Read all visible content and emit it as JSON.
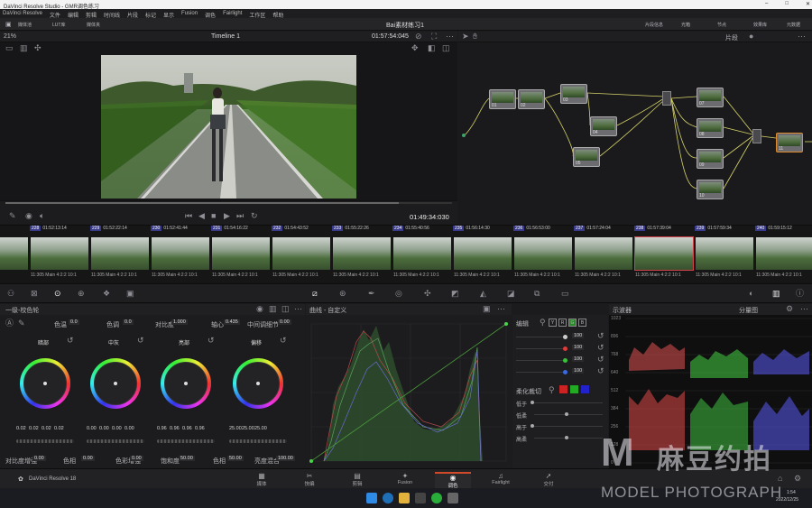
{
  "window": {
    "title": "DaVinci Resolve Studio - GMR调色练习",
    "controls": [
      "–",
      "□",
      "✕"
    ]
  },
  "menu": [
    "DaVinci Resolve",
    "文件",
    "编辑",
    "剪辑",
    "时间线",
    "片段",
    "标记",
    "显示",
    "Fusion",
    "调色",
    "Fairlight",
    "工作区",
    "帮助"
  ],
  "toolbar": {
    "left": [
      "媒体池",
      "LUT库",
      "媒体夹"
    ],
    "project": "Bai素材练习1",
    "right": [
      "片段信息",
      "光箱",
      "节点",
      "效果库",
      "元数据"
    ]
  },
  "viewer": {
    "zoom": "21%",
    "timeline": "Timeline 1",
    "timecode": "01:57:54:045",
    "playhead_tc": "01:49:34:030",
    "progress": 0.88
  },
  "nodes": {
    "mode": "片段",
    "items": [
      {
        "label": "01"
      },
      {
        "label": "02"
      },
      {
        "label": "03"
      },
      {
        "label": "04"
      },
      {
        "label": "05"
      },
      {
        "label": "07"
      },
      {
        "label": "08"
      },
      {
        "label": "09"
      },
      {
        "label": "10"
      },
      {
        "label": "11"
      },
      {
        "label": "12"
      }
    ]
  },
  "clips": [
    {
      "num": "",
      "tc": "4:14",
      "name": "11:305 Main"
    },
    {
      "num": "228",
      "tc": "01:52:13:14",
      "name": "11:305 Main 4:2:2 10:1"
    },
    {
      "num": "229",
      "tc": "01:52:22:14",
      "name": "11:305 Main 4:2:2 10:1"
    },
    {
      "num": "230",
      "tc": "01:52:41:44",
      "name": "11:305 Main 4:2:2 10:1"
    },
    {
      "num": "231",
      "tc": "01:54:16:22",
      "name": "11:305 Main 4:2:2 10:1"
    },
    {
      "num": "232",
      "tc": "01:54:43:52",
      "name": "11:305 Main 4:2:2 10:1"
    },
    {
      "num": "233",
      "tc": "01:55:22:26",
      "name": "11:305 Main 4:2:2 10:1"
    },
    {
      "num": "234",
      "tc": "01:55:40:56",
      "name": "11:305 Main 4:2:2 10:1"
    },
    {
      "num": "235",
      "tc": "01:56:14:30",
      "name": "11:305 Main 4:2:2 10:1"
    },
    {
      "num": "236",
      "tc": "01:56:53:00",
      "name": "11:305 Main 4:2:2 10:1"
    },
    {
      "num": "237",
      "tc": "01:57:24:04",
      "name": "11:305 Main 4:2:2 10:1"
    },
    {
      "num": "238",
      "tc": "01:57:39:04",
      "name": "11:305 Main 4:2:2 10:1"
    },
    {
      "num": "239",
      "tc": "01:57:59:34",
      "name": "11:305 Main 4:2:2 10:1"
    },
    {
      "num": "240",
      "tc": "01:59:15:12",
      "name": "11:305 Main 4:2:2 10:1"
    }
  ],
  "primaries": {
    "title": "一级-校色轮",
    "top": {
      "temp_label": "色温",
      "temp": "0.0",
      "tint_label": "色调",
      "tint": "0.0",
      "contrast_label": "对比度",
      "contrast": "1.000",
      "pivot_label": "轴心",
      "pivot": "0.435",
      "md_label": "中间调细节",
      "md": "0.00"
    },
    "wheels": [
      {
        "name": "暗部",
        "vals": [
          "0.02",
          "0.02",
          "0.02",
          "0.02"
        ]
      },
      {
        "name": "中灰",
        "vals": [
          "0.00",
          "0.00",
          "0.00",
          "0.00"
        ]
      },
      {
        "name": "亮部",
        "vals": [
          "0.96",
          "0.96",
          "0.96",
          "0.96"
        ]
      },
      {
        "name": "偏移",
        "vals": [
          "25.00",
          "25.00",
          "25.00"
        ]
      }
    ],
    "bottom": {
      "ca_label": "对比度增强",
      "ca": "0.00",
      "hue_label": "色相",
      "hue": "0.00",
      "color_boost_label": "色彩增强",
      "color_boost": "0.00",
      "sat_label": "饱和度",
      "sat": "50.00",
      "hue2_label": "色相",
      "hue2": "50.00",
      "lm_label": "亮度混合",
      "lm": "100.00"
    }
  },
  "curves": {
    "title": "曲线 - 自定义",
    "edit_label": "编辑",
    "channels": [
      "Y",
      "R",
      "G",
      "B"
    ],
    "intensity": [
      "100",
      "100",
      "100",
      "100"
    ],
    "soft_clip_label": "柔化裁切",
    "soft_rows": [
      "低于",
      "低柔",
      "高于",
      "高柔"
    ]
  },
  "scope": {
    "title": "示波器",
    "mode": "分量图",
    "ticks": [
      "1023",
      "896",
      "768",
      "640",
      "512",
      "384",
      "256",
      "128",
      "0"
    ]
  },
  "pages": [
    {
      "label": "媒体",
      "glyph": "▦"
    },
    {
      "label": "快编",
      "glyph": "✂"
    },
    {
      "label": "剪辑",
      "glyph": "▤"
    },
    {
      "label": "Fusion",
      "glyph": "✦"
    },
    {
      "label": "调色",
      "glyph": "◉"
    },
    {
      "label": "Fairlight",
      "glyph": "♫"
    },
    {
      "label": "交付",
      "glyph": "➚"
    }
  ],
  "app_name": "DaVinci Resolve 18",
  "watermark": {
    "brand": "麻豆约拍",
    "sub": "MODEL PHOTOGRAPH"
  },
  "clock": {
    "time": "1:54",
    "date": "2022/12/25"
  }
}
